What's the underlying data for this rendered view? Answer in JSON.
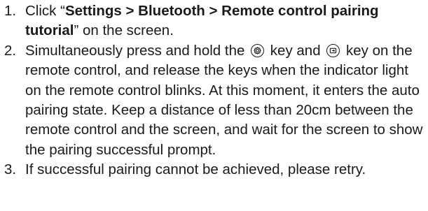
{
  "steps": [
    {
      "number": "1.",
      "prefix": "Click “",
      "bold": "Settings > Bluetooth > Remote control pairing tutorial",
      "suffix": "” on the screen."
    },
    {
      "number": "2.",
      "part1": "Simultaneously press and hold the",
      "icon1": "settings-gear-icon",
      "part2": "key and",
      "icon2": "input-source-icon",
      "part3": "key on the remote control, and release the keys when the indicator light on the remote control blinks. At this moment, it enters the auto pairing state. Keep a distance of less than 20cm between the remote control and the screen, and wait for the screen to show the pairing successful prompt."
    },
    {
      "number": "3.",
      "text": "If successful pairing cannot be achieved, please retry."
    }
  ]
}
